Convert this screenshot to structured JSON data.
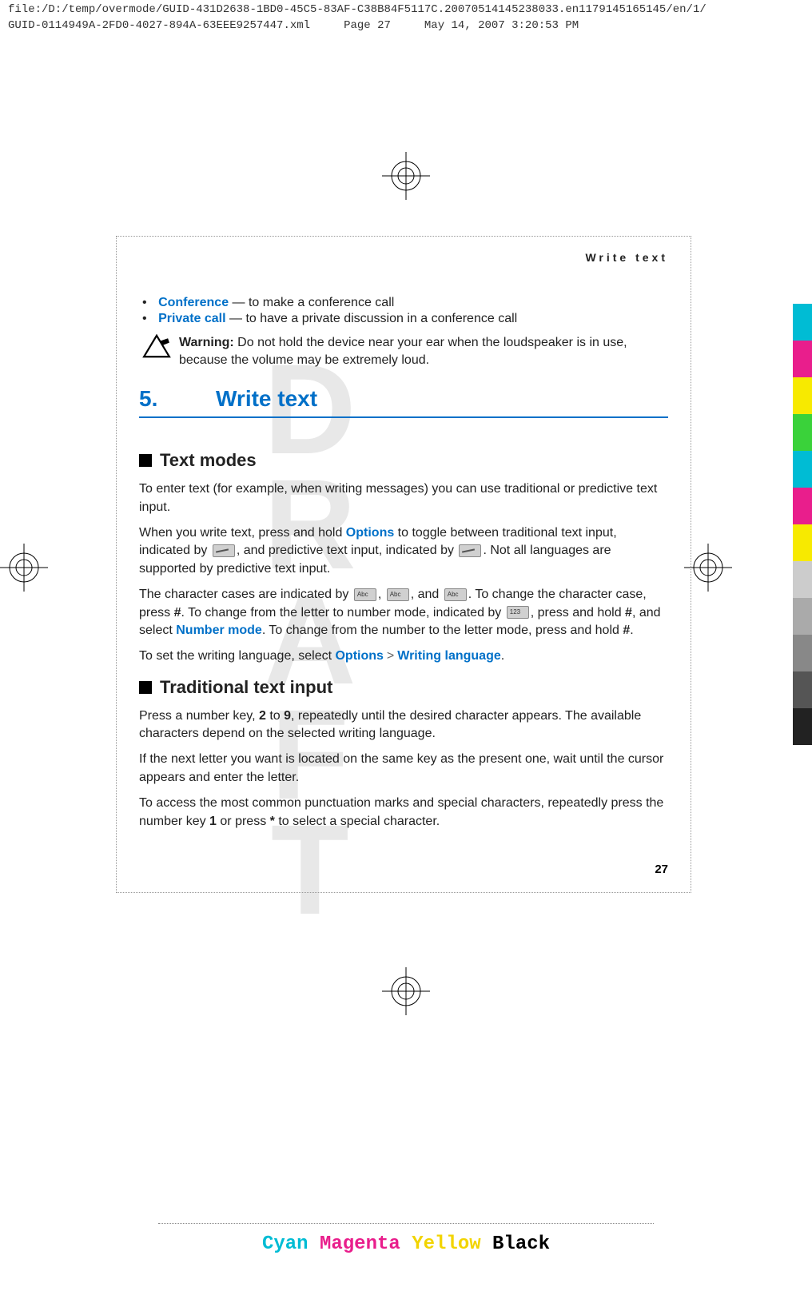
{
  "header": {
    "line1": "file:/D:/temp/overmode/GUID-431D2638-1BD0-45C5-83AF-C38B84F5117C.20070514145238033.en1179145165145/en/1/",
    "line2_file": "GUID-0114949A-2FD0-4027-894A-63EEE9257447.xml",
    "line2_page": "Page 27",
    "line2_date": "May 14, 2007 3:20:53 PM"
  },
  "running_head": "Write text",
  "bullets": [
    {
      "term": "Conference",
      "desc": " —  to make a conference call"
    },
    {
      "term": "Private call",
      "desc": " — to have a private discussion in a conference call"
    }
  ],
  "warning": {
    "label": "Warning:",
    "text": "  Do not hold the device near your ear when the loudspeaker is in use, because the volume may be extremely loud."
  },
  "chapter": {
    "number": "5.",
    "title": "Write text"
  },
  "section1": {
    "heading": "Text modes",
    "p1": "To enter text (for example, when writing messages) you can use traditional or predictive text input.",
    "p2a": "When you write text, press and hold ",
    "p2_link1": "Options",
    "p2b": " to toggle between traditional text input, indicated by ",
    "p2c": ", and predictive text input, indicated by ",
    "p2d": ". Not all languages are supported by predictive text input.",
    "p3a": "The character cases are indicated by ",
    "p3b": ", ",
    "p3c": ", and ",
    "p3d": ". To change the character case, press ",
    "p3_hash1": "#",
    "p3e": ". To change from the letter to number mode, indicated by ",
    "p3f": ", press and hold ",
    "p3_hash2": "#",
    "p3g": ", and select ",
    "p3_link2": "Number mode",
    "p3h": ". To change from the number to the letter mode, press and hold ",
    "p3_hash3": "#",
    "p3i": ".",
    "p4a": "To set the writing language, select ",
    "p4_link1": "Options",
    "p4_gt": ">",
    "p4_link2": "Writing language",
    "p4b": "."
  },
  "section2": {
    "heading": "Traditional text input",
    "p1a": "Press a number key, ",
    "p1_b1": "2",
    "p1b": " to ",
    "p1_b2": "9",
    "p1c": ", repeatedly until the desired character appears. The available characters depend on the selected writing language.",
    "p2": "If the next letter you want is located on the same key as the present one, wait until the cursor appears and enter the letter.",
    "p3a": "To access the most common punctuation marks and special characters, repeatedly press the number key ",
    "p3_b1": "1",
    "p3b": " or press ",
    "p3_b2": "*",
    "p3c": " to select a special character."
  },
  "page_number": "27",
  "watermark": "DRAFT",
  "footer": {
    "cyan": "Cyan",
    "magenta": "Magenta",
    "yellow": "Yellow",
    "black": "Black"
  },
  "color_bars": [
    "#00bcd4",
    "#e91e8c",
    "#f7ea00",
    "#3ad23a",
    "#00bcd4",
    "#e91e8c",
    "#f7ea00",
    "#cccccc",
    "#aaaaaa",
    "#888888",
    "#555555",
    "#222222"
  ]
}
